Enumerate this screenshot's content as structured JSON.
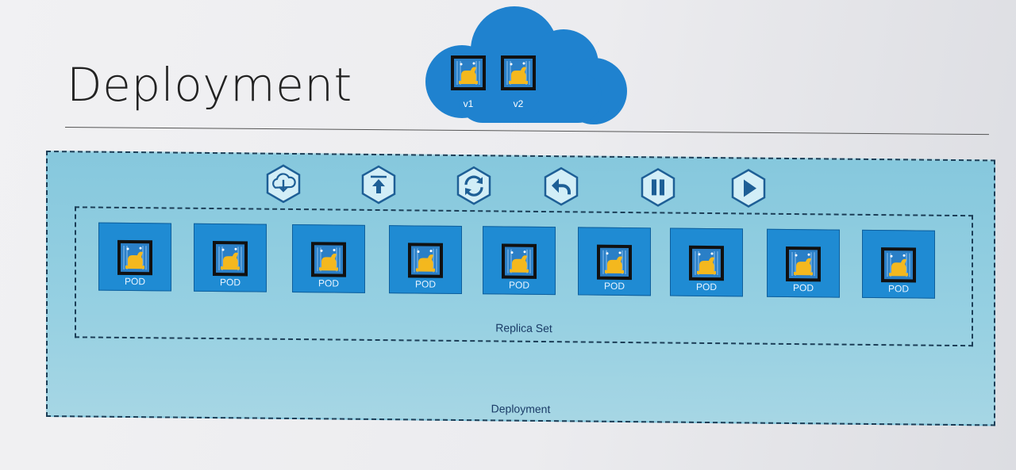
{
  "slide": {
    "title": "Deployment"
  },
  "cloud": {
    "versions": [
      {
        "label": "v1"
      },
      {
        "label": "v2"
      }
    ]
  },
  "deployment": {
    "label": "Deployment",
    "actions": [
      {
        "icon": "download-icon"
      },
      {
        "icon": "upload-icon"
      },
      {
        "icon": "refresh-icon"
      },
      {
        "icon": "undo-icon"
      },
      {
        "icon": "pause-icon"
      },
      {
        "icon": "play-icon"
      }
    ],
    "replica_set": {
      "label": "Replica Set",
      "pods": [
        {
          "label": "POD"
        },
        {
          "label": "POD"
        },
        {
          "label": "POD"
        },
        {
          "label": "POD"
        },
        {
          "label": "POD"
        },
        {
          "label": "POD"
        },
        {
          "label": "POD"
        },
        {
          "label": "POD"
        },
        {
          "label": "POD"
        }
      ]
    }
  },
  "colors": {
    "cloud": "#1f82cf",
    "pod": "#1f8bd3",
    "deployment_fill": "#8ecbe0",
    "icon_stroke": "#1e5f96",
    "logo_yellow": "#f4b81e"
  }
}
